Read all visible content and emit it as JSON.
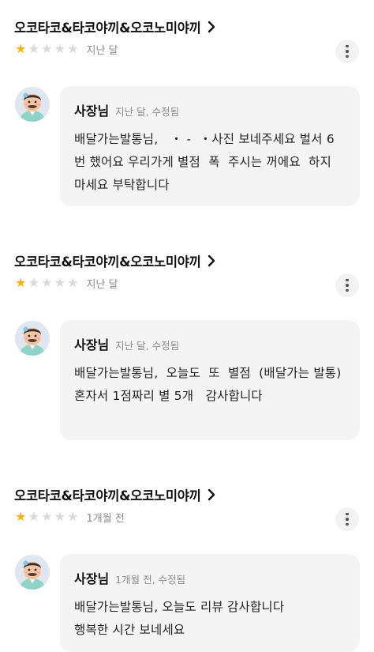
{
  "reviews": [
    {
      "store_name": "오코타코&타코야끼&오코노미야끼",
      "rating": 1,
      "rating_max": 5,
      "date": "지난 달",
      "reply": {
        "owner": "사장님",
        "meta": "지난 달, 수정됨",
        "text": "배달가는발통님,   ・ -  ・사진 보네주세요 벌서 6번 했어요 우리가게 별점  폭  주시는 꺼에요  하지 마세요 부탁합니다"
      }
    },
    {
      "store_name": "오코타코&타코야끼&오코노미야끼",
      "rating": 1,
      "rating_max": 5,
      "date": "지난 달",
      "reply": {
        "owner": "사장님",
        "meta": "지난 달, 수정됨",
        "text": "배달가는발통님,  오늘도  또  별점  (배달가는 발통) 혼자서 1점짜리 별 5개   감사합니다"
      }
    },
    {
      "store_name": "오코타코&타코야끼&오코노미야끼",
      "rating": 1,
      "rating_max": 5,
      "date": "1개월 전",
      "reply": {
        "owner": "사장님",
        "meta": "1개월 전, 수정됨",
        "text": "배달가는발통님, 오늘도 리뷰 감사합니다\n행복한 시간 보네세요"
      }
    }
  ],
  "icons": {
    "star": "star-icon",
    "more": "more-vertical-icon",
    "chevron": "chevron-right-icon",
    "avatar": "owner-avatar"
  },
  "colors": {
    "star_on": "#f5b400",
    "star_off": "#d9d9d9",
    "bubble_bg": "#f4f4f4",
    "meta_text": "#8a8a8a"
  }
}
